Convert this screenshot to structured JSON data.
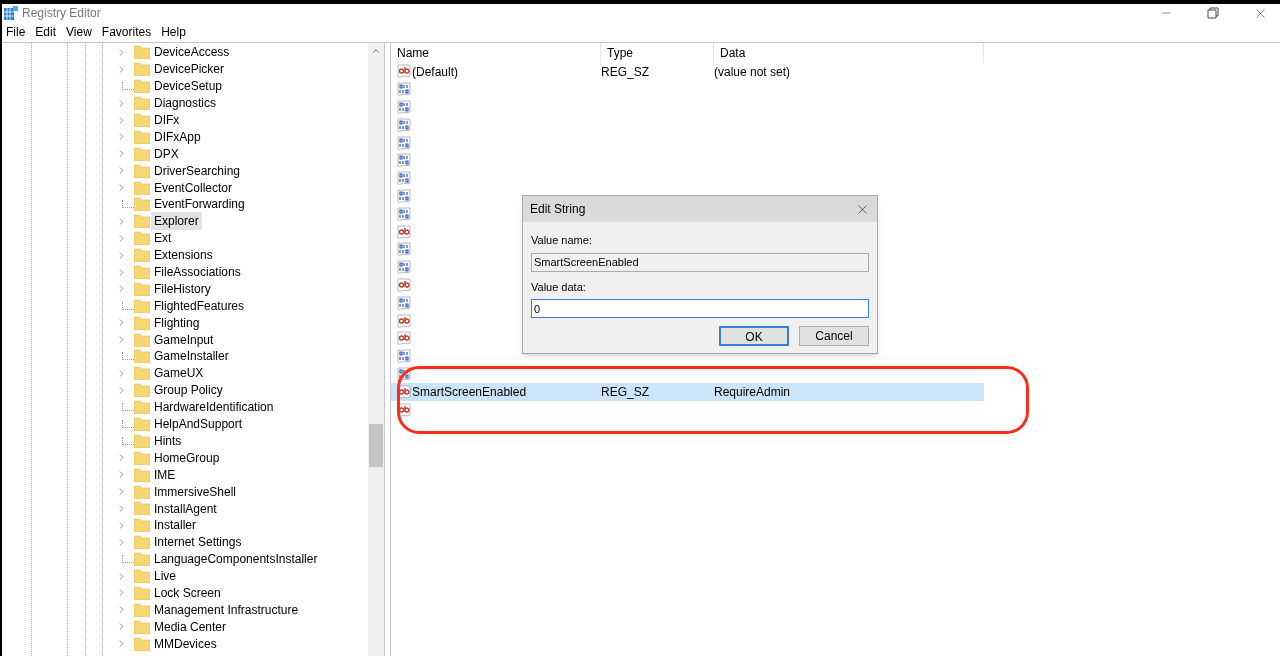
{
  "window": {
    "title": "Registry Editor"
  },
  "menu": [
    "File",
    "Edit",
    "View",
    "Favorites",
    "Help"
  ],
  "tree": {
    "items": [
      {
        "label": "DeviceAccess",
        "expandable": true,
        "selected": false
      },
      {
        "label": "DevicePicker",
        "expandable": true,
        "selected": false
      },
      {
        "label": "DeviceSetup",
        "expandable": false,
        "selected": false
      },
      {
        "label": "Diagnostics",
        "expandable": true,
        "selected": false
      },
      {
        "label": "DIFx",
        "expandable": true,
        "selected": false
      },
      {
        "label": "DIFxApp",
        "expandable": true,
        "selected": false
      },
      {
        "label": "DPX",
        "expandable": true,
        "selected": false
      },
      {
        "label": "DriverSearching",
        "expandable": true,
        "selected": false
      },
      {
        "label": "EventCollector",
        "expandable": true,
        "selected": false
      },
      {
        "label": "EventForwarding",
        "expandable": false,
        "selected": false
      },
      {
        "label": "Explorer",
        "expandable": true,
        "selected": true
      },
      {
        "label": "Ext",
        "expandable": true,
        "selected": false
      },
      {
        "label": "Extensions",
        "expandable": true,
        "selected": false
      },
      {
        "label": "FileAssociations",
        "expandable": true,
        "selected": false
      },
      {
        "label": "FileHistory",
        "expandable": true,
        "selected": false
      },
      {
        "label": "FlightedFeatures",
        "expandable": false,
        "selected": false
      },
      {
        "label": "Flighting",
        "expandable": true,
        "selected": false
      },
      {
        "label": "GameInput",
        "expandable": true,
        "selected": false
      },
      {
        "label": "GameInstaller",
        "expandable": false,
        "selected": false
      },
      {
        "label": "GameUX",
        "expandable": true,
        "selected": false
      },
      {
        "label": "Group Policy",
        "expandable": true,
        "selected": false
      },
      {
        "label": "HardwareIdentification",
        "expandable": false,
        "selected": false
      },
      {
        "label": "HelpAndSupport",
        "expandable": false,
        "selected": false
      },
      {
        "label": "Hints",
        "expandable": false,
        "selected": false
      },
      {
        "label": "HomeGroup",
        "expandable": true,
        "selected": false
      },
      {
        "label": "IME",
        "expandable": true,
        "selected": false
      },
      {
        "label": "ImmersiveShell",
        "expandable": true,
        "selected": false
      },
      {
        "label": "InstallAgent",
        "expandable": true,
        "selected": false
      },
      {
        "label": "Installer",
        "expandable": true,
        "selected": false
      },
      {
        "label": "Internet Settings",
        "expandable": true,
        "selected": false
      },
      {
        "label": "LanguageComponentsInstaller",
        "expandable": false,
        "selected": false
      },
      {
        "label": "Live",
        "expandable": true,
        "selected": false
      },
      {
        "label": "Lock Screen",
        "expandable": true,
        "selected": false
      },
      {
        "label": "Management Infrastructure",
        "expandable": true,
        "selected": false
      },
      {
        "label": "Media Center",
        "expandable": true,
        "selected": false
      },
      {
        "label": "MMDevices",
        "expandable": true,
        "selected": false
      }
    ]
  },
  "values": {
    "columns": [
      "Name",
      "Type",
      "Data"
    ],
    "rows": [
      {
        "kind": "string",
        "name": "(Default)",
        "type": "REG_SZ",
        "data": "(value not set)",
        "selected": false
      },
      {
        "kind": "binary",
        "selected": false
      },
      {
        "kind": "binary",
        "selected": false
      },
      {
        "kind": "binary",
        "selected": false
      },
      {
        "kind": "binary",
        "selected": false
      },
      {
        "kind": "binary",
        "selected": false
      },
      {
        "kind": "binary",
        "selected": false
      },
      {
        "kind": "binary",
        "selected": false
      },
      {
        "kind": "binary",
        "selected": false
      },
      {
        "kind": "string",
        "selected": false
      },
      {
        "kind": "binary",
        "selected": false
      },
      {
        "kind": "binary",
        "selected": false
      },
      {
        "kind": "string",
        "selected": false
      },
      {
        "kind": "binary",
        "selected": false
      },
      {
        "kind": "string",
        "selected": false
      },
      {
        "kind": "string",
        "selected": false
      },
      {
        "kind": "binary",
        "selected": false
      },
      {
        "kind": "binary",
        "selected": false
      },
      {
        "kind": "string",
        "name": "SmartScreenEnabled",
        "type": "REG_SZ",
        "data": "RequireAdmin",
        "selected": true
      },
      {
        "kind": "string",
        "selected": false
      }
    ]
  },
  "dialog": {
    "title": "Edit String",
    "value_name_label": "Value name:",
    "value_name": "SmartScreenEnabled",
    "value_data_label": "Value data:",
    "value_data": "0",
    "buttons": [
      {
        "label": "OK",
        "default": true
      },
      {
        "label": "Cancel",
        "default": false
      }
    ]
  }
}
